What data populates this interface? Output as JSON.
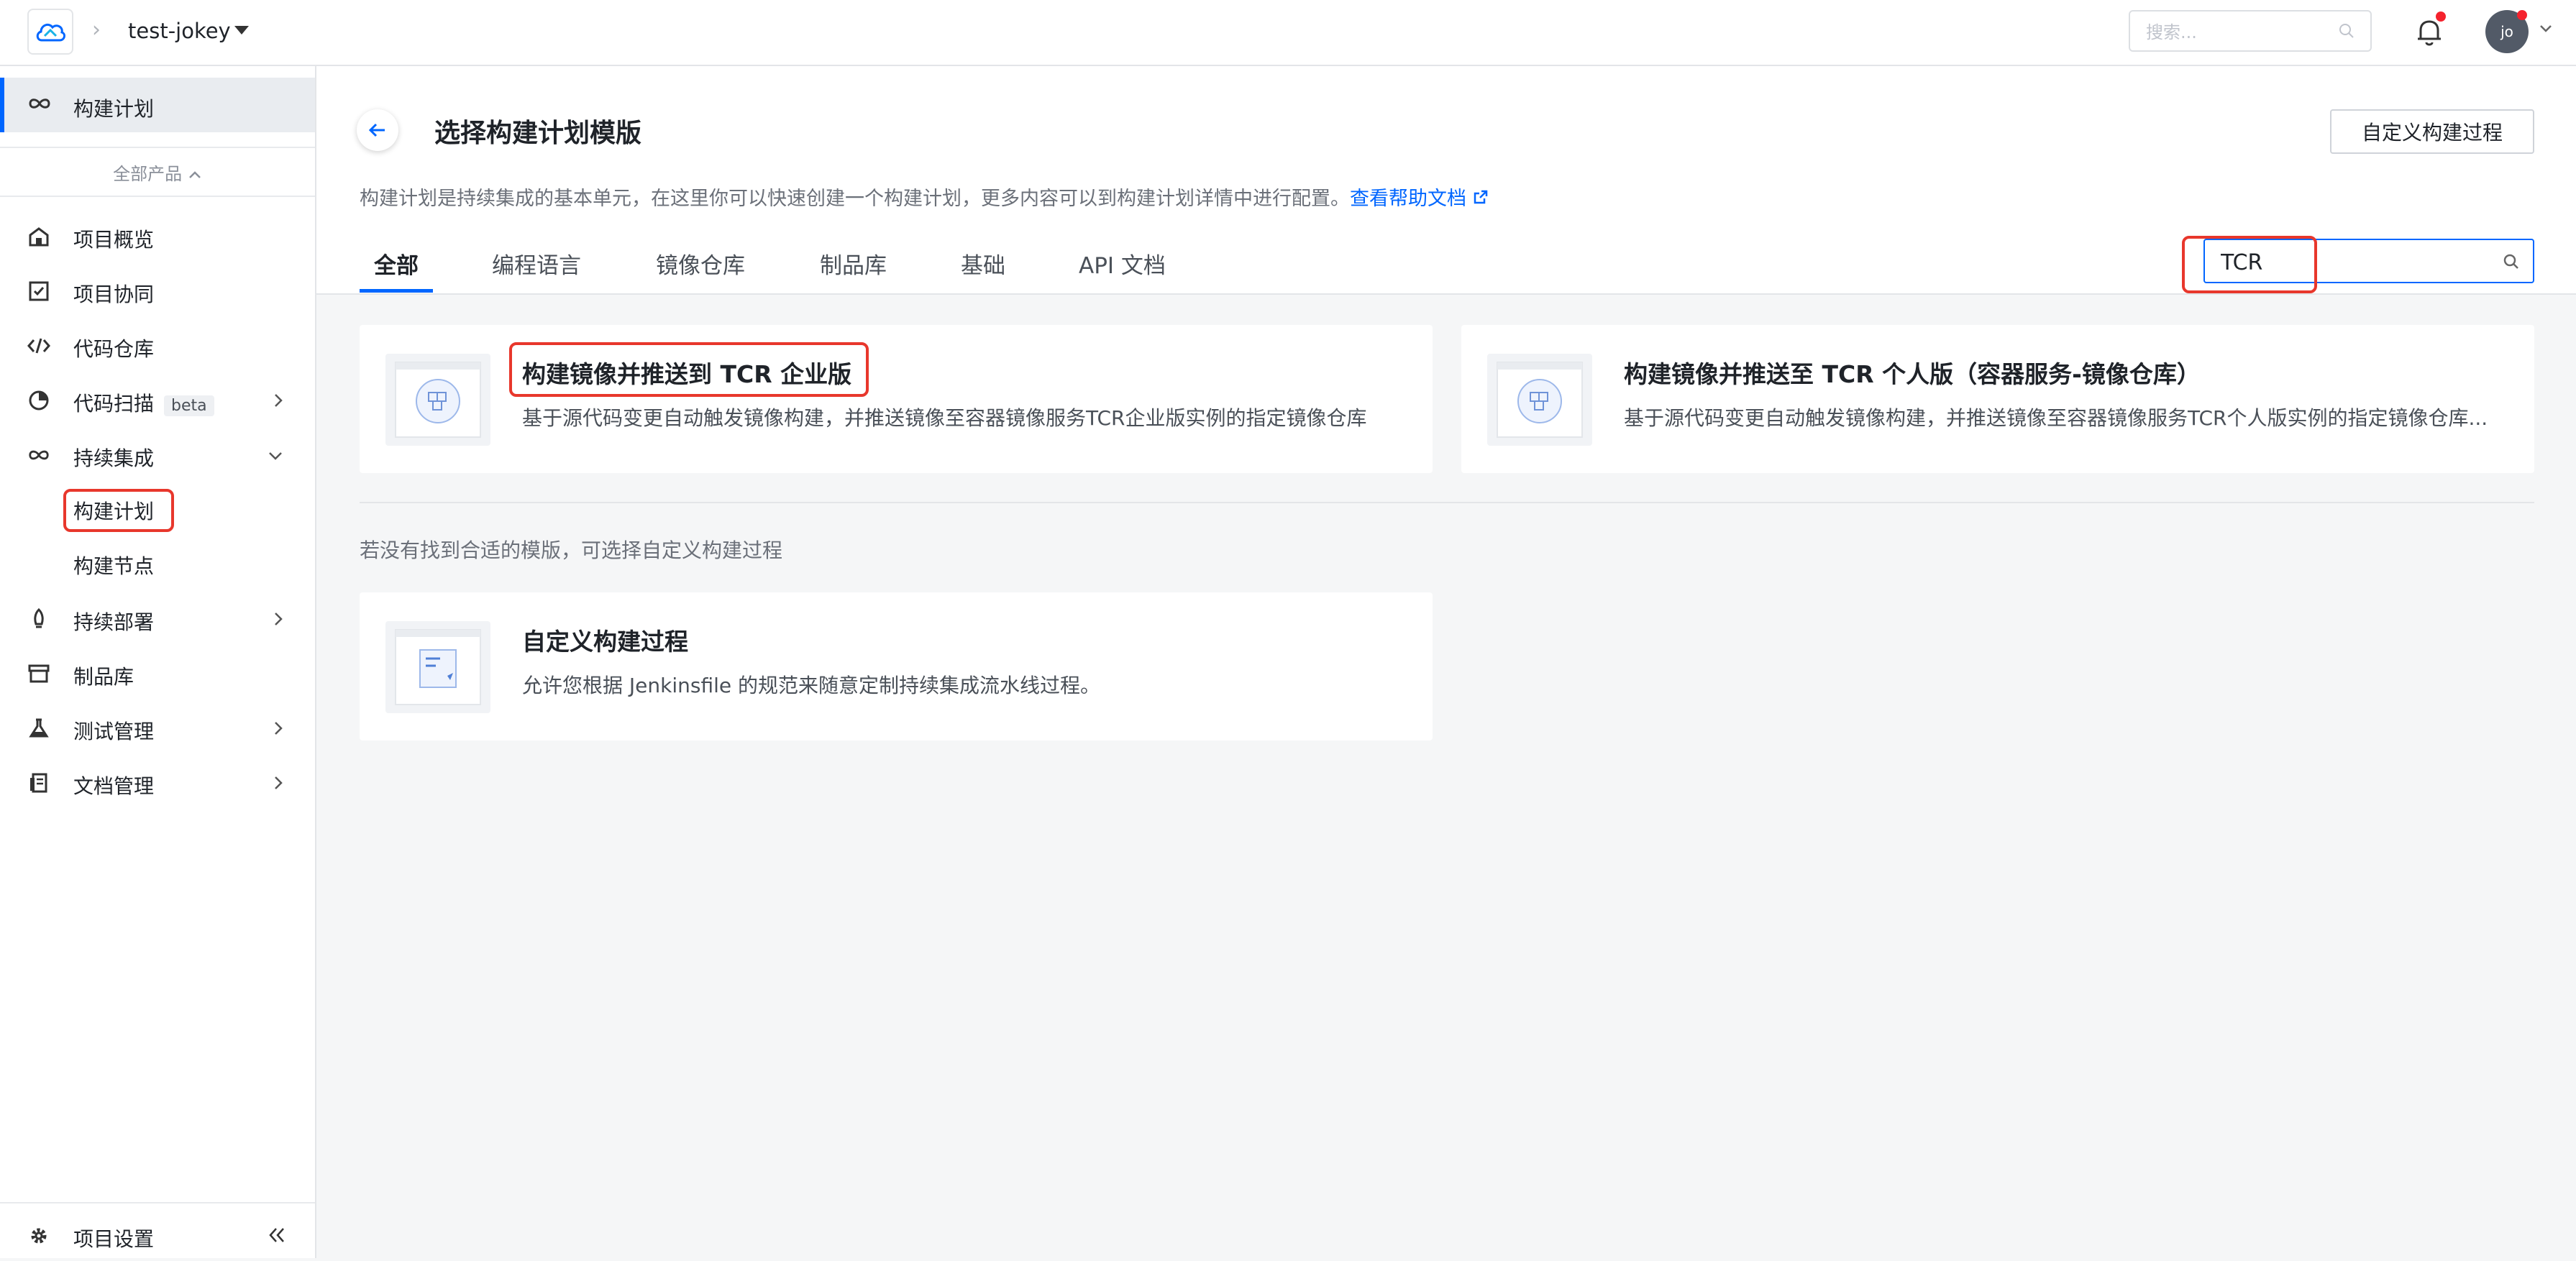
{
  "topbar": {
    "project_name": "test-jokey",
    "search_placeholder": "搜索...",
    "avatar_initials": "jo"
  },
  "sidebar": {
    "pinned_item": "构建计划",
    "all_products_label": "全部产品",
    "items": [
      {
        "label": "项目概览",
        "icon": "home-icon"
      },
      {
        "label": "项目协同",
        "icon": "checkbox-icon"
      },
      {
        "label": "代码仓库",
        "icon": "code-icon"
      },
      {
        "label": "代码扫描",
        "icon": "scan-icon",
        "badge": "beta"
      },
      {
        "label": "持续集成",
        "icon": "infinity-icon"
      },
      {
        "label": "持续部署",
        "icon": "rocket-icon"
      },
      {
        "label": "制品库",
        "icon": "box-icon"
      },
      {
        "label": "测试管理",
        "icon": "flask-icon"
      },
      {
        "label": "文档管理",
        "icon": "doc-icon"
      }
    ],
    "ci_sub_items": [
      "构建计划",
      "构建节点"
    ],
    "settings_label": "项目设置"
  },
  "main": {
    "title": "选择构建计划模版",
    "custom_button": "自定义构建过程",
    "description": "构建计划是持续集成的基本单元，在这里你可以快速创建一个构建计划，更多内容可以到构建计划详情中进行配置。",
    "help_link": "查看帮助文档",
    "tabs": [
      "全部",
      "编程语言",
      "镜像仓库",
      "制品库",
      "基础",
      "API 文档"
    ],
    "search_value": "TCR",
    "cards": [
      {
        "title": "构建镜像并推送到 TCR 企业版",
        "description": "基于源代码变更自动触发镜像构建，并推送镜像至容器镜像服务TCR企业版实例的指定镜像仓库"
      },
      {
        "title": "构建镜像并推送至 TCR 个人版（容器服务-镜像仓库）",
        "description": "基于源代码变更自动触发镜像构建，并推送镜像至容器镜像服务TCR个人版实例的指定镜像仓库..."
      }
    ],
    "hint": "若没有找到合适的模版，可选择自定义构建过程",
    "custom_card": {
      "title": "自定义构建过程",
      "description": "允许您根据 Jenkinsfile 的规范来随意定制持续集成流水线过程。"
    }
  },
  "colors": {
    "accent": "#0066ff",
    "highlight_box": "#e8372c",
    "notification_dot": "#f5222d"
  }
}
